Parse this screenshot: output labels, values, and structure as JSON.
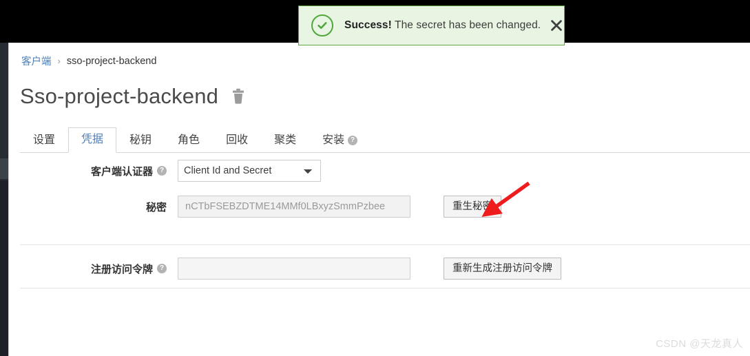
{
  "alert": {
    "strong_text": "Success!",
    "message": " The secret has been changed.",
    "icon": "check-circle-icon",
    "close_icon": "close-icon",
    "border_color": "#61a543",
    "background_color": "#e8f5e3"
  },
  "breadcrumb": {
    "parent": "客户端",
    "separator": "›",
    "current": "sso-project-backend"
  },
  "header": {
    "title": "Sso-project-backend",
    "delete_icon": "trash-icon"
  },
  "tabs": [
    {
      "label": "设置",
      "active": false,
      "help": false
    },
    {
      "label": "凭据",
      "active": true,
      "help": false
    },
    {
      "label": "秘钥",
      "active": false,
      "help": false
    },
    {
      "label": "角色",
      "active": false,
      "help": false
    },
    {
      "label": "回收",
      "active": false,
      "help": false
    },
    {
      "label": "聚类",
      "active": false,
      "help": false
    },
    {
      "label": "安装",
      "active": false,
      "help": true
    }
  ],
  "form": {
    "client_authenticator": {
      "label": "客户端认证器",
      "help_icon": "question-mark-icon",
      "selected": "Client Id and Secret",
      "options": [
        "Client Id and Secret"
      ]
    },
    "secret": {
      "label": "秘密",
      "value": "nCTbFSEBZDTME14MMf0LBxyzSmmPzbee",
      "button": "重生秘密"
    },
    "registration_access_token": {
      "label": "注册访问令牌",
      "help_icon": "question-mark-icon",
      "value": "",
      "placeholder": "",
      "button": "重新生成注册访问令牌"
    }
  },
  "annotation": {
    "arrow_color": "#ee1c1c",
    "points_to": "重生秘密"
  },
  "watermark": "CSDN @天龙真人",
  "help_glyph": "?"
}
